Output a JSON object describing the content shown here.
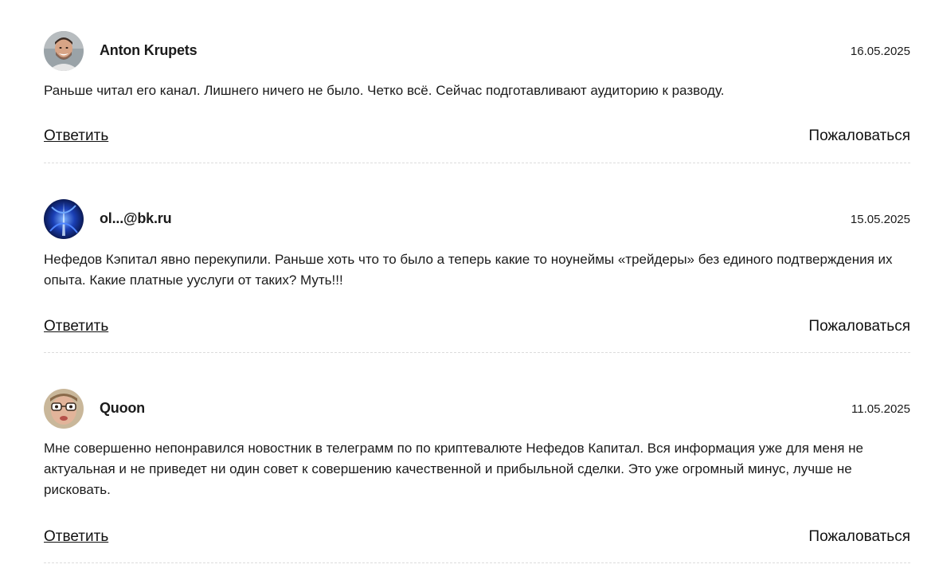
{
  "comments": [
    {
      "author": "Anton Krupets",
      "date": "16.05.2025",
      "text": "Раньше читал его канал. Лишнего ничего не было. Четко всё. Сейчас подготавливают аудиторию к разводу.",
      "avatar_icon": "man-portrait-avatar-icon",
      "reply_label": "Ответить",
      "report_label": "Пожаловаться"
    },
    {
      "author": "ol...@bk.ru",
      "date": "15.05.2025",
      "text": "Нефедов Кэпитал явно перекупили. Раньше хоть что то было а теперь какие то ноунеймы «трейдеры» без единого подтверждения их опыта. Какие платные ууслуги от таких? Муть!!!",
      "avatar_icon": "blue-abstract-avatar-icon",
      "reply_label": "Ответить",
      "report_label": "Пожаловаться"
    },
    {
      "author": "Quoon",
      "date": "11.05.2025",
      "text": "Мне совершенно непонравился новостник в телеграмм по по криптевалюте Нефедов Капитал. Вся информация уже для меня не актуальная и не приведет ни один совет к совершению качественной и прибыльной сделки. Это уже огромный минус, лучше не рисковать.",
      "avatar_icon": "face-with-glasses-avatar-icon",
      "reply_label": "Ответить",
      "report_label": "Пожаловаться"
    }
  ],
  "colors": {
    "text": "#1b1b1b",
    "divider": "#dcdcdc",
    "background": "#ffffff"
  }
}
